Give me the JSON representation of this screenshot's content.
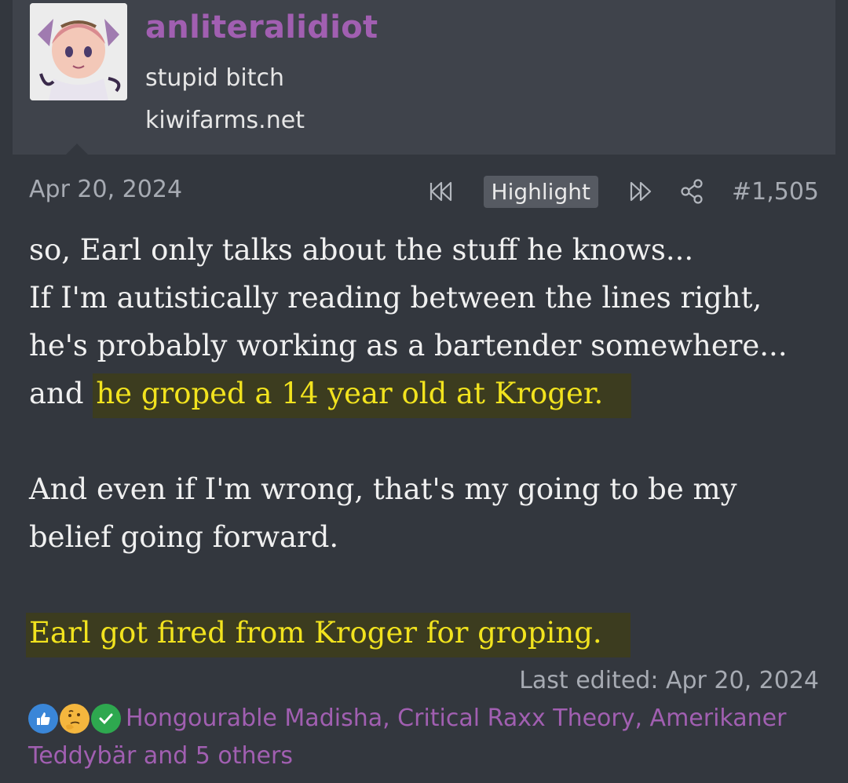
{
  "user": {
    "username": "anliteralidiot",
    "title": "stupid bitch",
    "site": "kiwifarms.net"
  },
  "post": {
    "date": "Apr 20, 2024",
    "highlight_label": "Highlight",
    "number": "#1,505",
    "lines": [
      "so, Earl only talks about the stuff he knows...",
      "If I'm autistically reading between the lines right,",
      "he's probably working as a bartender somewhere...",
      "and ",
      "he groped a 14 year old at Kroger.",
      "And even if I'm wrong, that's my going to be my",
      "belief going forward.",
      "Earl got fired from Kroger for groping."
    ],
    "last_edited": "Last edited: Apr 20, 2024"
  },
  "reactions": {
    "icons": [
      "like-icon",
      "thinking-icon",
      "check-icon"
    ],
    "text": "Hongourable Madisha, Critical Raxx Theory, Amerikaner Teddybär and 5 others"
  },
  "colors": {
    "background": "#33373e",
    "header": "#3f434b",
    "username": "#a15fb1",
    "highlight_text": "#f2e31e",
    "highlight_bg": "#3c3c1f"
  }
}
